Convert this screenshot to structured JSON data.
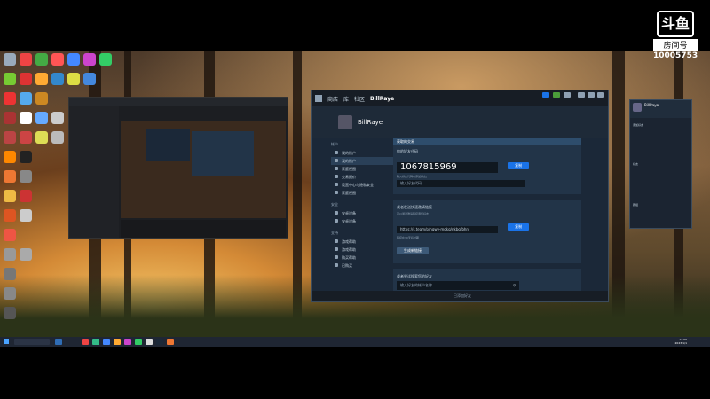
{
  "watermark": {
    "logo": "斗鱼",
    "label": "房间号",
    "room_number": "10005753"
  },
  "steam": {
    "nav": [
      "商店",
      "库",
      "社区",
      "BillRaye"
    ],
    "profile_name": "BillRaye",
    "menu_section_1": "帐户",
    "menu_items_1": [
      "我的账户",
      "我的账户",
      "家庭视图",
      "交易报价",
      "设置中心与隐私安全",
      "家庭视图"
    ],
    "menu_section_2": "安全",
    "menu_items_2": [
      "安卓设备",
      "安卓设备"
    ],
    "menu_section_3": "支持",
    "menu_items_3": [
      "游戏帮助",
      "游戏帮助",
      "购买帮助",
      "已购买"
    ],
    "panel1_header": "获取的交易",
    "code_label": "你的好友代码",
    "friend_code": "1067815969",
    "copy_button": "复制",
    "code_hint": "输入好友代码以添加好友。",
    "code_input_placeholder": "输入好友代码",
    "panel2_title": "或者发送快速邀请链接",
    "invite_desc": "可以通过邀请链接添加好友",
    "invite_url": "https://s.team/p/hqwv-mgkq/nkbqfbhn",
    "invite_copy": "复制",
    "invite_note": "链接在30天后过期",
    "new_link_button": "生成新链接",
    "panel3_title": "或者尝试搜索您的好友",
    "search_placeholder": "输入好友的帐户名称",
    "bottom_status": "已添加好友"
  },
  "friends_panel": {
    "user": "BillRaye",
    "rows": [
      "添加好友",
      "好友",
      "群组"
    ]
  },
  "taskbar": {
    "time": "12:00",
    "date": "2023/1/1"
  },
  "colors": {
    "steam_bg": "#1b2838",
    "steam_accent": "#1a73e8",
    "desktop_glow": "#f6c96a"
  }
}
